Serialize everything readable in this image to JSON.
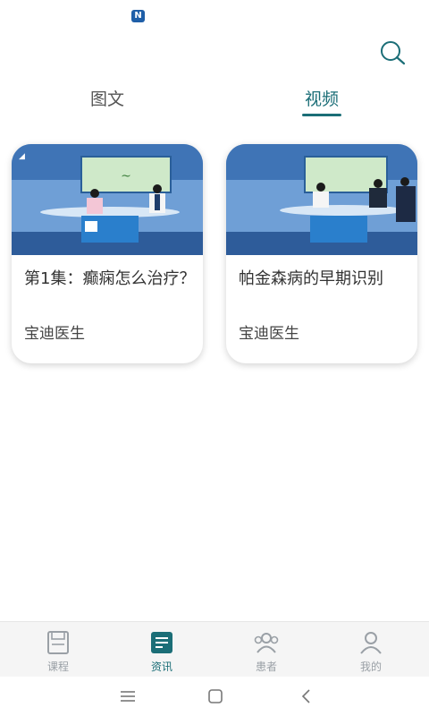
{
  "status_bar": {
    "app_icon_letter": "N"
  },
  "header": {
    "search_icon": "search-icon"
  },
  "tabs": [
    {
      "label": "图文",
      "active": false
    },
    {
      "label": "视频",
      "active": true
    }
  ],
  "cards": [
    {
      "title": "第1集：癫痫怎么治疗？",
      "author": "宝迪医生",
      "thumbnail": "tv-studio-interview"
    },
    {
      "title": "帕金森病的早期识别",
      "author": "宝迪医生",
      "thumbnail": "tv-studio-interview"
    }
  ],
  "bottom_nav": [
    {
      "label": "课程",
      "icon": "course-book-icon",
      "active": false
    },
    {
      "label": "资讯",
      "icon": "news-icon",
      "active": true
    },
    {
      "label": "患者",
      "icon": "patients-icon",
      "active": false
    },
    {
      "label": "我的",
      "icon": "profile-icon",
      "active": false
    }
  ],
  "colors": {
    "accent": "#1b6e77",
    "inactive": "#9aa0a6"
  }
}
